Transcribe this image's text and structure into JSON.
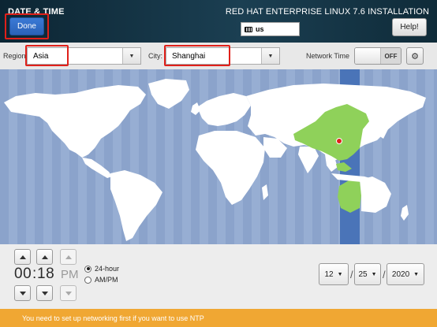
{
  "header": {
    "title": "DATE & TIME",
    "done_label": "Done",
    "product_title": "RED HAT ENTERPRISE LINUX 7.6 INSTALLATION",
    "keyboard_layout": "us",
    "help_label": "Help!"
  },
  "toolbar": {
    "region_label": "Region:",
    "region_value": "Asia",
    "city_label": "City:",
    "city_value": "Shanghai",
    "network_time_label": "Network Time",
    "network_time_state": "OFF"
  },
  "time": {
    "hours": "00",
    "separator": ":",
    "minutes": "18",
    "period": "PM",
    "format_24h_label": "24-hour",
    "format_ampm_label": "AM/PM",
    "selected_format": "24-hour"
  },
  "date": {
    "month": "12",
    "day": "25",
    "year": "2020",
    "separator": "/"
  },
  "warning": {
    "message": "You need to set up networking first if you want to use NTP"
  },
  "colors": {
    "header_bg": "#15384a",
    "done_button": "#2f6cc8",
    "highlight_box": "#e0201a",
    "map_ocean": "#8ba3cb",
    "land": "#ffffff",
    "selected_timezone_land": "#8fd15a",
    "selected_timezone_band": "#4a74b8",
    "warning_bar": "#f0a733"
  }
}
